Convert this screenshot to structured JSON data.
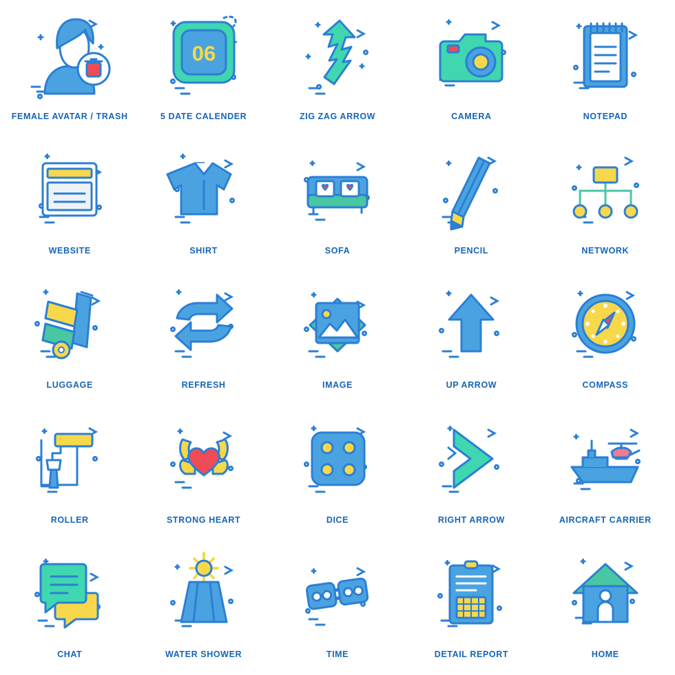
{
  "palette": {
    "label_color": "#1565b8",
    "outline": "#2b7fd4",
    "blue": "#4aa3e0",
    "blue_dark": "#2b7fd4",
    "teal": "#3fd6b0",
    "green": "#49c6a2",
    "yellow": "#f7d84b",
    "red": "#ef4b57",
    "pink": "#f07a8f",
    "white": "#ffffff",
    "light": "#eef2f5"
  },
  "icons": [
    {
      "id": "female-avatar-trash",
      "label": "FEMALE AVATAR / TRASH"
    },
    {
      "id": "5-date-calender",
      "label": "5 DATE CALENDER",
      "value": "06"
    },
    {
      "id": "zig-zag-arrow",
      "label": "ZIG ZAG ARROW"
    },
    {
      "id": "camera",
      "label": "CAMERA"
    },
    {
      "id": "notepad",
      "label": "NOTEPAD"
    },
    {
      "id": "website",
      "label": "WEBSITE"
    },
    {
      "id": "shirt",
      "label": "SHIRT"
    },
    {
      "id": "sofa",
      "label": "SOFA"
    },
    {
      "id": "pencil",
      "label": "PENCIL"
    },
    {
      "id": "network",
      "label": "NETWORK"
    },
    {
      "id": "luggage",
      "label": "LUGGAGE"
    },
    {
      "id": "refresh",
      "label": "REFRESH"
    },
    {
      "id": "image",
      "label": "IMAGE"
    },
    {
      "id": "up-arrow",
      "label": "UP ARROW"
    },
    {
      "id": "compass",
      "label": "COMPASS"
    },
    {
      "id": "roller",
      "label": "ROLLER"
    },
    {
      "id": "strong-heart",
      "label": "STRONG HEART"
    },
    {
      "id": "dice",
      "label": "DICE"
    },
    {
      "id": "right-arrow",
      "label": "RIGHT ARROW"
    },
    {
      "id": "aircraft-carrier",
      "label": "AIRCRAFT CARRIER"
    },
    {
      "id": "chat",
      "label": "CHAT"
    },
    {
      "id": "water-shower",
      "label": "WATER SHOWER"
    },
    {
      "id": "time",
      "label": "TIME"
    },
    {
      "id": "detail-report",
      "label": "DETAIL REPORT"
    },
    {
      "id": "home",
      "label": "HOME"
    }
  ]
}
